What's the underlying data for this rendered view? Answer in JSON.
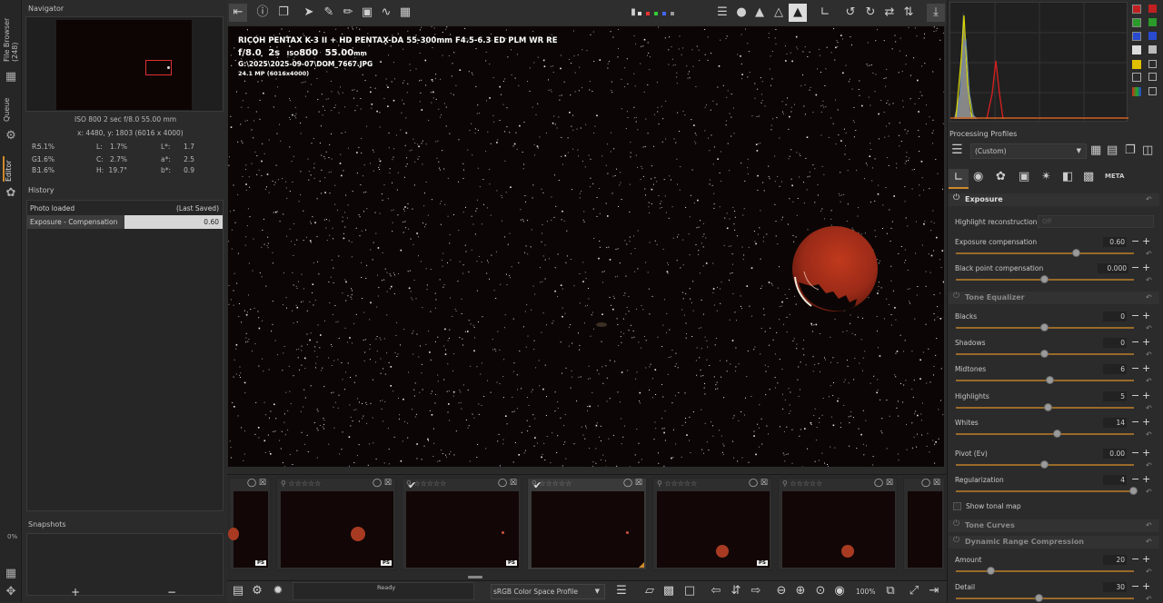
{
  "vtabs": {
    "file_browser": "File Browser (248)",
    "queue": "Queue",
    "editor": "Editor",
    "zoom_pct": "0%"
  },
  "navigator": {
    "title": "Navigator",
    "exposure": "ISO 800   2 sec   f/8.0   55.00 mm",
    "coords": "x: 4480, y: 1803   (6016 x 4000)",
    "rgb": [
      {
        "a": "R:",
        "av": "5.1%",
        "b": "L:",
        "bv": "1.7%",
        "c": "L*:",
        "cv": "1.7"
      },
      {
        "a": "G:",
        "av": "1.6%",
        "b": "C:",
        "bv": "2.7%",
        "c": "a*:",
        "cv": "2.5"
      },
      {
        "a": "B:",
        "av": "1.6%",
        "b": "H:",
        "bv": "19.7°",
        "c": "b*:",
        "cv": "0.9"
      }
    ]
  },
  "history": {
    "title": "History",
    "rows": [
      {
        "label": "Photo loaded",
        "value": "(Last Saved)"
      },
      {
        "label": "Exposure - Compensation",
        "value": "0.60"
      }
    ]
  },
  "snapshots": {
    "title": "Snapshots",
    "add": "+",
    "remove": "−"
  },
  "image": {
    "line1": "RICOH PENTAX K-3 II + HD PENTAX-DA 55-300mm F4.5-6.3 ED PLM WR RE",
    "line2_f": "f/8.0",
    "line2_s": "2s",
    "line2_iso_label": "ISO",
    "line2_iso": "800",
    "line2_fl": "55.00",
    "line2_mm": "mm",
    "line3": "G:\\2025\\2025-09-07\\DOM_7667.JPG",
    "line4": "24.1 MP (6016x4000)"
  },
  "filmstrip": {
    "ps_badge": "PS"
  },
  "bottom": {
    "status": "Ready",
    "color_profile": "sRGB Color Space Profile",
    "zoom": "100%"
  },
  "processing_profiles": {
    "title": "Processing Profiles",
    "value": "(Custom)"
  },
  "exposure": {
    "title": "Exposure",
    "highlight_label": "Highlight reconstruction:",
    "highlight_value": "Off",
    "comp_label": "Exposure compensation",
    "comp_value": "0.60",
    "black_label": "Black point compensation",
    "black_value": "0.000"
  },
  "tone_eq": {
    "title": "Tone Equalizer",
    "sliders": [
      {
        "label": "Blacks",
        "value": "0"
      },
      {
        "label": "Shadows",
        "value": "0"
      },
      {
        "label": "Midtones",
        "value": "6"
      },
      {
        "label": "Highlights",
        "value": "5"
      },
      {
        "label": "Whites",
        "value": "14"
      },
      {
        "label": "Pivot (Ev)",
        "value": "0.00"
      },
      {
        "label": "Regularization",
        "value": "4"
      }
    ],
    "show_tonal_map": "Show tonal map"
  },
  "tone_curves": {
    "title": "Tone Curves"
  },
  "drc": {
    "title": "Dynamic Range Compression",
    "amount_label": "Amount",
    "amount_value": "20",
    "detail_label": "Detail",
    "detail_value": "30"
  },
  "tool_tabs": {
    "meta": "META"
  }
}
